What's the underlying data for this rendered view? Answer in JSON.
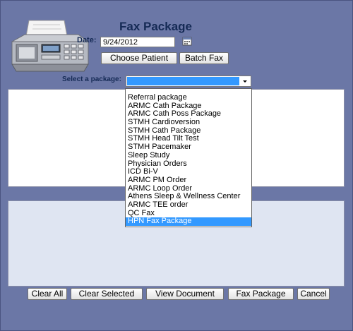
{
  "window": {
    "title": "Fax Package"
  },
  "date": {
    "label": "Date:",
    "value": "9/24/2012"
  },
  "buttons": {
    "choose_patient": "Choose Patient",
    "batch_fax": "Batch Fax",
    "clear_all": "Clear All",
    "clear_selected": "Clear Selected",
    "view_document": "View Document",
    "fax_package": "Fax Package",
    "cancel": "Cancel"
  },
  "package_select": {
    "label": "Select a package:",
    "selected": "",
    "options": [
      "Referral package",
      "ARMC Cath Package",
      "ARMC Cath Poss Package",
      "STMH Cardioversion",
      "STMH Cath Package",
      "STMH Head Tilt Test",
      "STMH Pacemaker",
      "Sleep Study",
      "Physician Orders",
      "ICD Bi-V",
      "ARMC PM Order",
      "ARMC Loop Order",
      "Athens Sleep & Wellness Center",
      "ARMC TEE order",
      "QC Fax",
      "HPN Fax Package"
    ],
    "highlighted": "HPN Fax Package"
  },
  "icons": [
    "fax-machine-icon",
    "calendar-icon",
    "dropdown-arrow-icon"
  ],
  "colors": {
    "background": "#6b77a6",
    "title": "#152a55",
    "highlight": "#3399ff"
  }
}
